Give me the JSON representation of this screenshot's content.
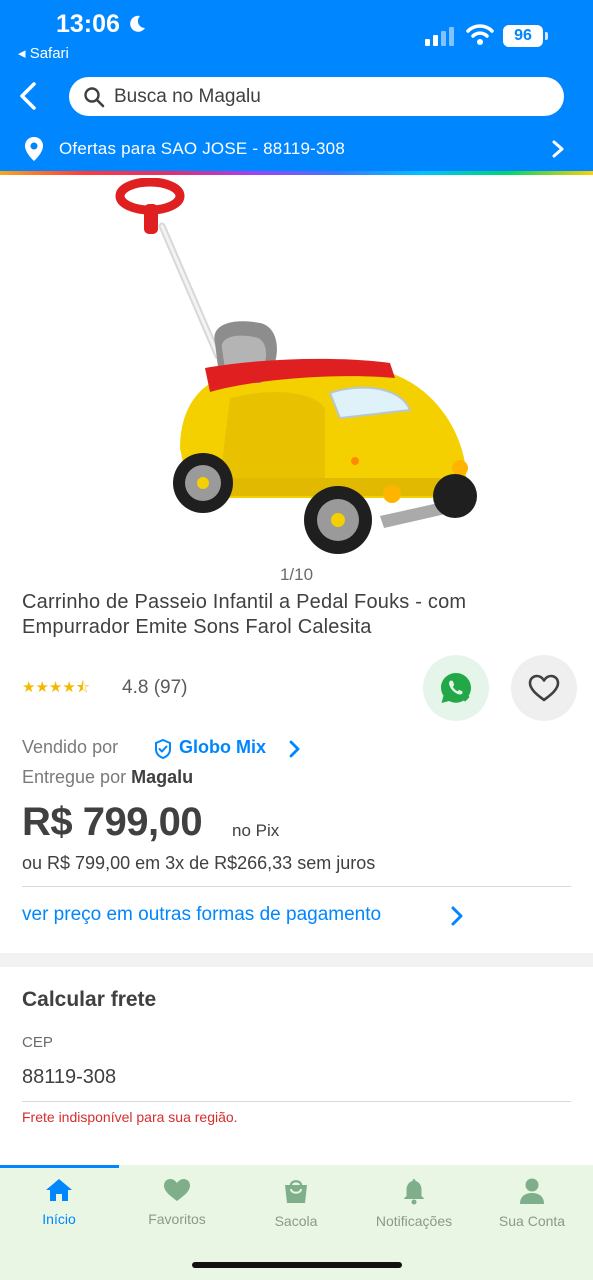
{
  "status_bar": {
    "time": "13:06",
    "back_app": "◂ Safari",
    "battery": "96"
  },
  "search": {
    "placeholder": "Busca no Magalu"
  },
  "location": {
    "text": "Ofertas para SAO JOSE - 88119-308"
  },
  "product": {
    "image_pager": "1/10",
    "title": "Carrinho de Passeio Infantil a Pedal Fouks - com Empurrador Emite Sons Farol Calesita",
    "stars": "★★★★⯪",
    "rating_text": "4.8 (97)",
    "sold_by_label": "Vendido por",
    "seller_name": "Globo Mix",
    "delivered_by_label": "Entregue por",
    "delivered_by_name": "Magalu",
    "price": "R$ 799,00",
    "price_suffix": "no Pix",
    "installments": "ou R$ 799,00 em 3x de R$266,33 sem juros",
    "payment_link": "ver preço em outras formas de pagamento"
  },
  "shipping": {
    "title": "Calcular frete",
    "cep_label": "CEP",
    "cep_value": "88119-308",
    "error": "Frete indisponível para sua região."
  },
  "bottom_nav": [
    {
      "label": "Início",
      "icon": "home-icon",
      "active": true
    },
    {
      "label": "Favoritos",
      "icon": "heart-icon",
      "active": false
    },
    {
      "label": "Sacola",
      "icon": "bag-icon",
      "active": false
    },
    {
      "label": "Notificações",
      "icon": "bell-icon",
      "active": false
    },
    {
      "label": "Sua Conta",
      "icon": "user-icon",
      "active": false
    }
  ],
  "colors": {
    "brand": "#0086ff",
    "rating": "#f5b800",
    "error": "#d62d2d",
    "nav_bg": "#e9f6e4"
  }
}
